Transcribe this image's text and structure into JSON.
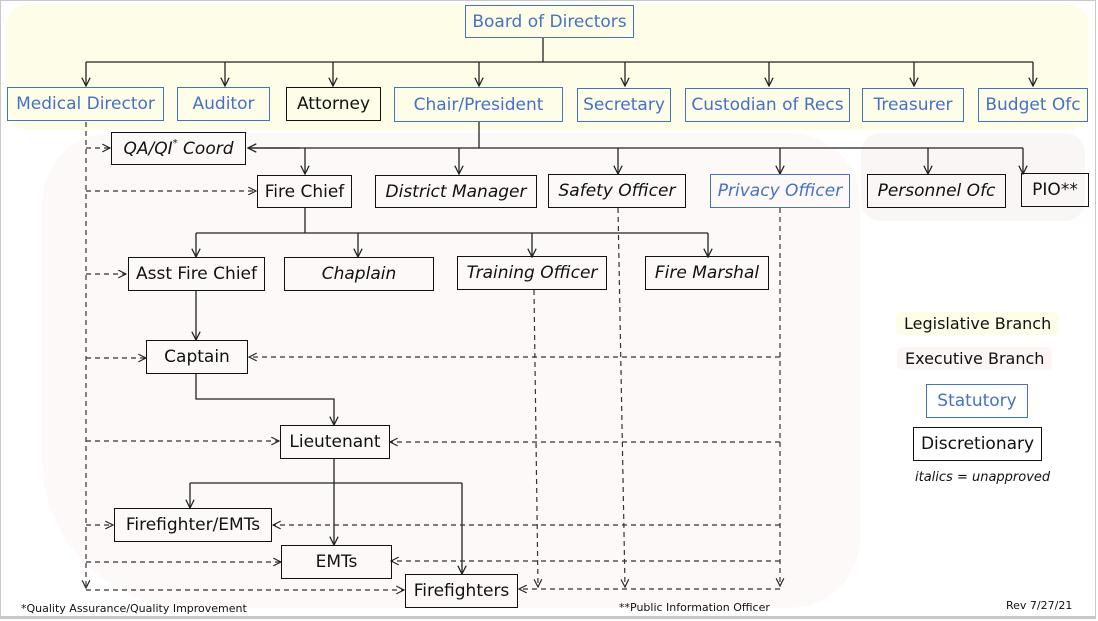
{
  "colors": {
    "statutory": "#4472c4",
    "discretionary": "#111111",
    "legislative_branch_bg": "#fefde7",
    "executive_branch_bg": "#fdf9f8"
  },
  "nodes": {
    "board": {
      "label": "Board of Directors",
      "type": "statutory",
      "italic": false
    },
    "medical_director": {
      "label": "Medical Director",
      "type": "statutory",
      "italic": false
    },
    "auditor": {
      "label": "Auditor",
      "type": "statutory",
      "italic": false
    },
    "attorney": {
      "label": "Attorney",
      "type": "discretionary",
      "italic": false
    },
    "chair_president": {
      "label": "Chair/President",
      "type": "statutory",
      "italic": false
    },
    "secretary": {
      "label": "Secretary",
      "type": "statutory",
      "italic": false
    },
    "custodian": {
      "label": "Custodian of Recs",
      "type": "statutory",
      "italic": false
    },
    "treasurer": {
      "label": "Treasurer",
      "type": "statutory",
      "italic": false
    },
    "budget_ofc": {
      "label": "Budget Ofc",
      "type": "statutory",
      "italic": false
    },
    "qa_qi": {
      "label": "QA/QI",
      "sup": "*",
      "suffix": " Coord",
      "type": "discretionary",
      "italic": true
    },
    "fire_chief": {
      "label": "Fire Chief",
      "type": "discretionary",
      "italic": false
    },
    "district_manager": {
      "label": "District Manager",
      "type": "discretionary",
      "italic": true
    },
    "safety_officer": {
      "label": "Safety Officer",
      "type": "discretionary",
      "italic": true
    },
    "privacy_officer": {
      "label": "Privacy Officer",
      "type": "statutory",
      "italic": true
    },
    "personnel_ofc": {
      "label": "Personnel Ofc",
      "type": "discretionary",
      "italic": true
    },
    "pio": {
      "label": "PIO**",
      "type": "discretionary",
      "italic": false
    },
    "asst_fire_chief": {
      "label": "Asst Fire Chief",
      "type": "discretionary",
      "italic": false
    },
    "chaplain": {
      "label": "Chaplain",
      "type": "discretionary",
      "italic": true
    },
    "training_officer": {
      "label": "Training Officer",
      "type": "discretionary",
      "italic": true
    },
    "fire_marshal": {
      "label": "Fire Marshal",
      "type": "discretionary",
      "italic": true
    },
    "captain": {
      "label": "Captain",
      "type": "discretionary",
      "italic": false
    },
    "lieutenant": {
      "label": "Lieutenant",
      "type": "discretionary",
      "italic": false
    },
    "firefighter_emts": {
      "label": "Firefighter/EMTs",
      "type": "discretionary",
      "italic": false
    },
    "emts": {
      "label": "EMTs",
      "type": "discretionary",
      "italic": false
    },
    "firefighters": {
      "label": "Firefighters",
      "type": "discretionary",
      "italic": false
    }
  },
  "edges": {
    "solid": [
      [
        "board",
        "medical_director"
      ],
      [
        "board",
        "auditor"
      ],
      [
        "board",
        "attorney"
      ],
      [
        "board",
        "chair_president"
      ],
      [
        "board",
        "secretary"
      ],
      [
        "board",
        "custodian"
      ],
      [
        "board",
        "treasurer"
      ],
      [
        "board",
        "budget_ofc"
      ],
      [
        "chair_president",
        "qa_qi"
      ],
      [
        "chair_president",
        "fire_chief"
      ],
      [
        "chair_president",
        "district_manager"
      ],
      [
        "chair_president",
        "safety_officer"
      ],
      [
        "chair_president",
        "privacy_officer"
      ],
      [
        "chair_president",
        "personnel_ofc"
      ],
      [
        "chair_president",
        "pio"
      ],
      [
        "fire_chief",
        "asst_fire_chief"
      ],
      [
        "fire_chief",
        "chaplain"
      ],
      [
        "fire_chief",
        "training_officer"
      ],
      [
        "fire_chief",
        "fire_marshal"
      ],
      [
        "asst_fire_chief",
        "captain"
      ],
      [
        "captain",
        "lieutenant"
      ],
      [
        "lieutenant",
        "firefighter_emts"
      ],
      [
        "lieutenant",
        "emts"
      ],
      [
        "lieutenant",
        "firefighters"
      ]
    ],
    "dashed": [
      [
        "medical_director",
        "qa_qi"
      ],
      [
        "medical_director",
        "fire_chief"
      ],
      [
        "medical_director",
        "asst_fire_chief"
      ],
      [
        "medical_director",
        "captain"
      ],
      [
        "medical_director",
        "lieutenant"
      ],
      [
        "medical_director",
        "firefighter_emts"
      ],
      [
        "medical_director",
        "emts"
      ],
      [
        "medical_director",
        "firefighters"
      ],
      [
        "privacy_officer",
        "captain"
      ],
      [
        "privacy_officer",
        "lieutenant"
      ],
      [
        "privacy_officer",
        "firefighter_emts"
      ],
      [
        "privacy_officer",
        "emts"
      ],
      [
        "privacy_officer",
        "firefighters"
      ],
      [
        "safety_officer",
        "firefighters"
      ],
      [
        "training_officer",
        "firefighters"
      ]
    ]
  },
  "legend": {
    "legislative": "Legislative Branch",
    "executive": "Executive Branch",
    "statutory": "Statutory",
    "discretionary": "Discretionary",
    "italics_note": "italics = unapproved"
  },
  "footnotes": {
    "qa": "*Quality Assurance/Quality Improvement",
    "pio": "**Public Information Officer",
    "revision": "Rev 7/27/21"
  }
}
